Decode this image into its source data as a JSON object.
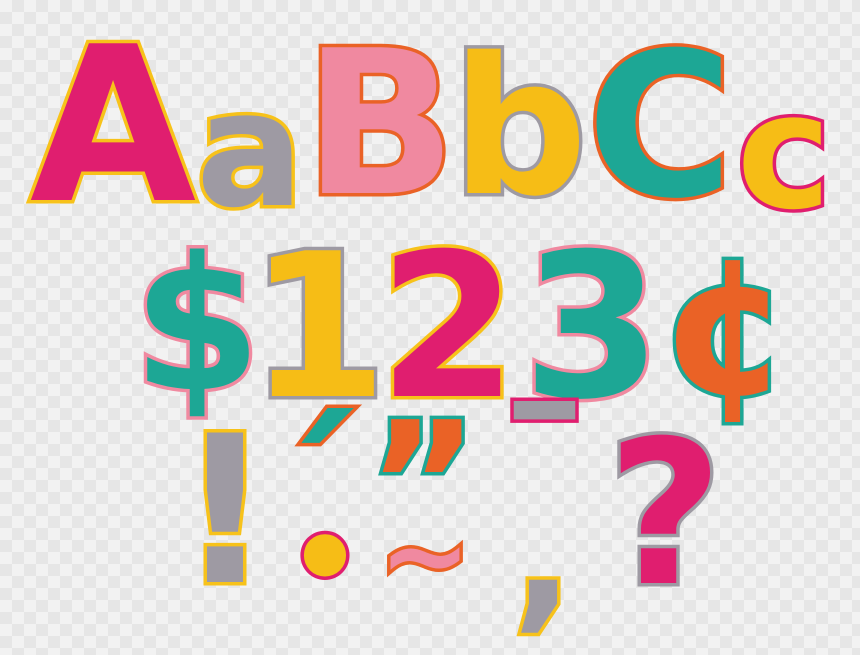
{
  "glyphs": [
    {
      "key": "A-upper",
      "char": "A",
      "fill": "#e01e6f",
      "stroke": "#f7c21a"
    },
    {
      "key": "a-lower",
      "char": "a",
      "fill": "#9e9aa3",
      "stroke": "#f7c21a"
    },
    {
      "key": "B-upper",
      "char": "B",
      "fill": "#f089a0",
      "stroke": "#ea6226"
    },
    {
      "key": "b-lower",
      "char": "b",
      "fill": "#f6bd16",
      "stroke": "#9e9aa3"
    },
    {
      "key": "C-upper",
      "char": "C",
      "fill": "#1da795",
      "stroke": "#ea6226"
    },
    {
      "key": "c-lower",
      "char": "c",
      "fill": "#f6bd16",
      "stroke": "#e01e6f"
    },
    {
      "key": "dollar",
      "char": "$",
      "fill": "#1da795",
      "stroke": "#f089a0"
    },
    {
      "key": "one",
      "char": "1",
      "fill": "#f6bd16",
      "stroke": "#9e9aa3"
    },
    {
      "key": "two",
      "char": "2",
      "fill": "#e01e6f",
      "stroke": "#f7c21a"
    },
    {
      "key": "three",
      "char": "3",
      "fill": "#1da795",
      "stroke": "#f089a0"
    },
    {
      "key": "cent",
      "char": "¢",
      "fill": "#ea6226",
      "stroke": "#1da795"
    },
    {
      "key": "exclamation",
      "char": "!",
      "fill": "#9e9aa3",
      "stroke": "#f7c21a"
    },
    {
      "key": "acute-accent",
      "char": "´",
      "fill": "#1da795",
      "stroke": "#ea6226"
    },
    {
      "key": "accent-dot",
      "char": "•",
      "fill": "#f6bd16",
      "stroke": "#e01e6f"
    },
    {
      "key": "quote",
      "char": "”",
      "fill": "#ea6226",
      "stroke": "#1da795"
    },
    {
      "key": "tilde",
      "char": "~",
      "fill": "#f089a0",
      "stroke": "#ea6226"
    },
    {
      "key": "macron",
      "char": "¯",
      "fill": "#9e9aa3",
      "stroke": "#e01e6f"
    },
    {
      "key": "comma",
      "char": ",",
      "fill": "#9e9aa3",
      "stroke": "#f7c21a"
    },
    {
      "key": "question",
      "char": "?",
      "fill": "#e01e6f",
      "stroke": "#9e9aa3"
    }
  ]
}
